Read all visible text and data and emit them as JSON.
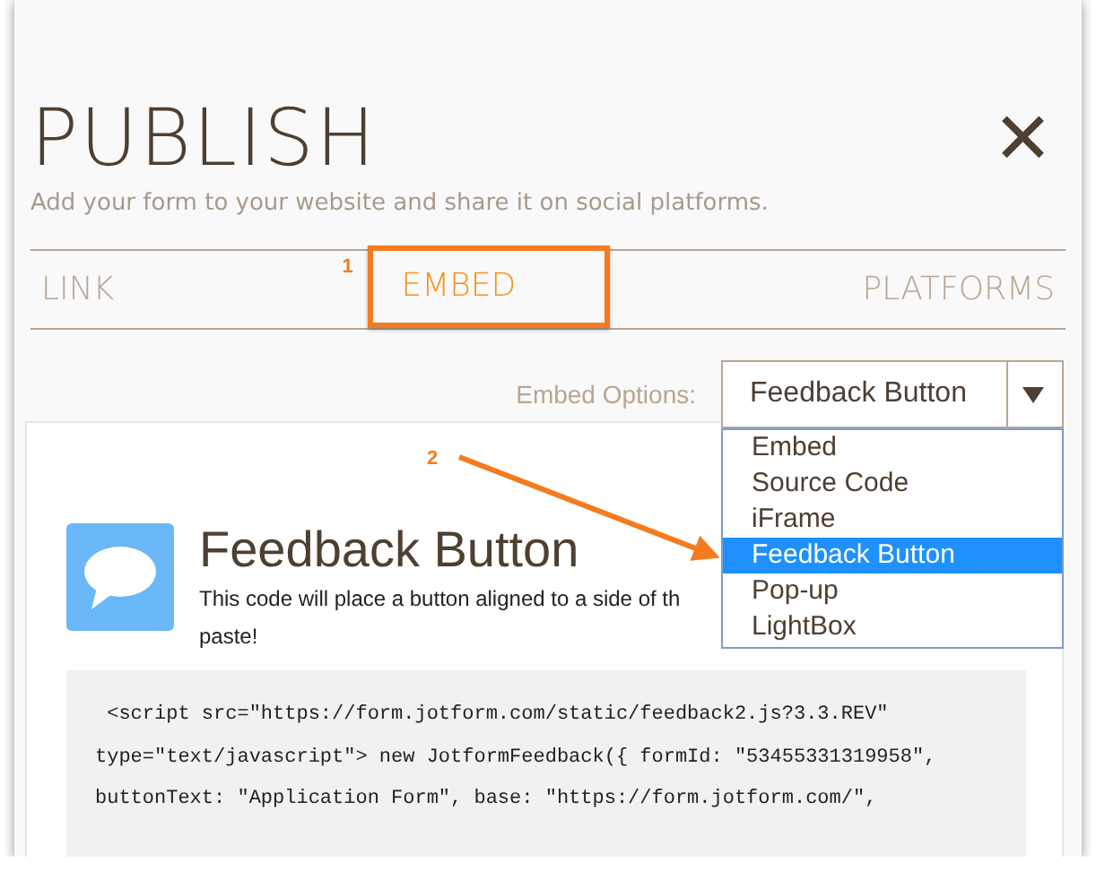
{
  "header": {
    "title": "PUBLISH",
    "subtitle": "Add your form to your website and share it on social platforms.",
    "close": "✕"
  },
  "tabs": [
    {
      "label": "LINK",
      "selected": false
    },
    {
      "label": "EMBED",
      "selected": true,
      "callout": "1"
    },
    {
      "label": "PLATFORMS",
      "selected": false
    }
  ],
  "embed_options": {
    "label": "Embed Options:",
    "value": "Feedback Button",
    "expanded": true,
    "options": [
      {
        "label": "Embed",
        "selected": false
      },
      {
        "label": "Source Code",
        "selected": false
      },
      {
        "label": "iFrame",
        "selected": false
      },
      {
        "label": "Feedback Button",
        "selected": true
      },
      {
        "label": "Pop-up",
        "selected": false
      },
      {
        "label": "LightBox",
        "selected": false
      }
    ],
    "callout": "2"
  },
  "card": {
    "title": "Feedback Button",
    "description_lines": [
      "This code will place a button aligned to a side of th",
      "paste!"
    ],
    "code_lines": [
      " <script src=\"https://form.jotform.com/static/feedback2.js?3.3.REV\"",
      "type=\"text/javascript\"> new JotformFeedback({ formId: \"53455331319958\",",
      "buttonText: \"Application Form\", base: \"https://form.jotform.com/\","
    ]
  }
}
